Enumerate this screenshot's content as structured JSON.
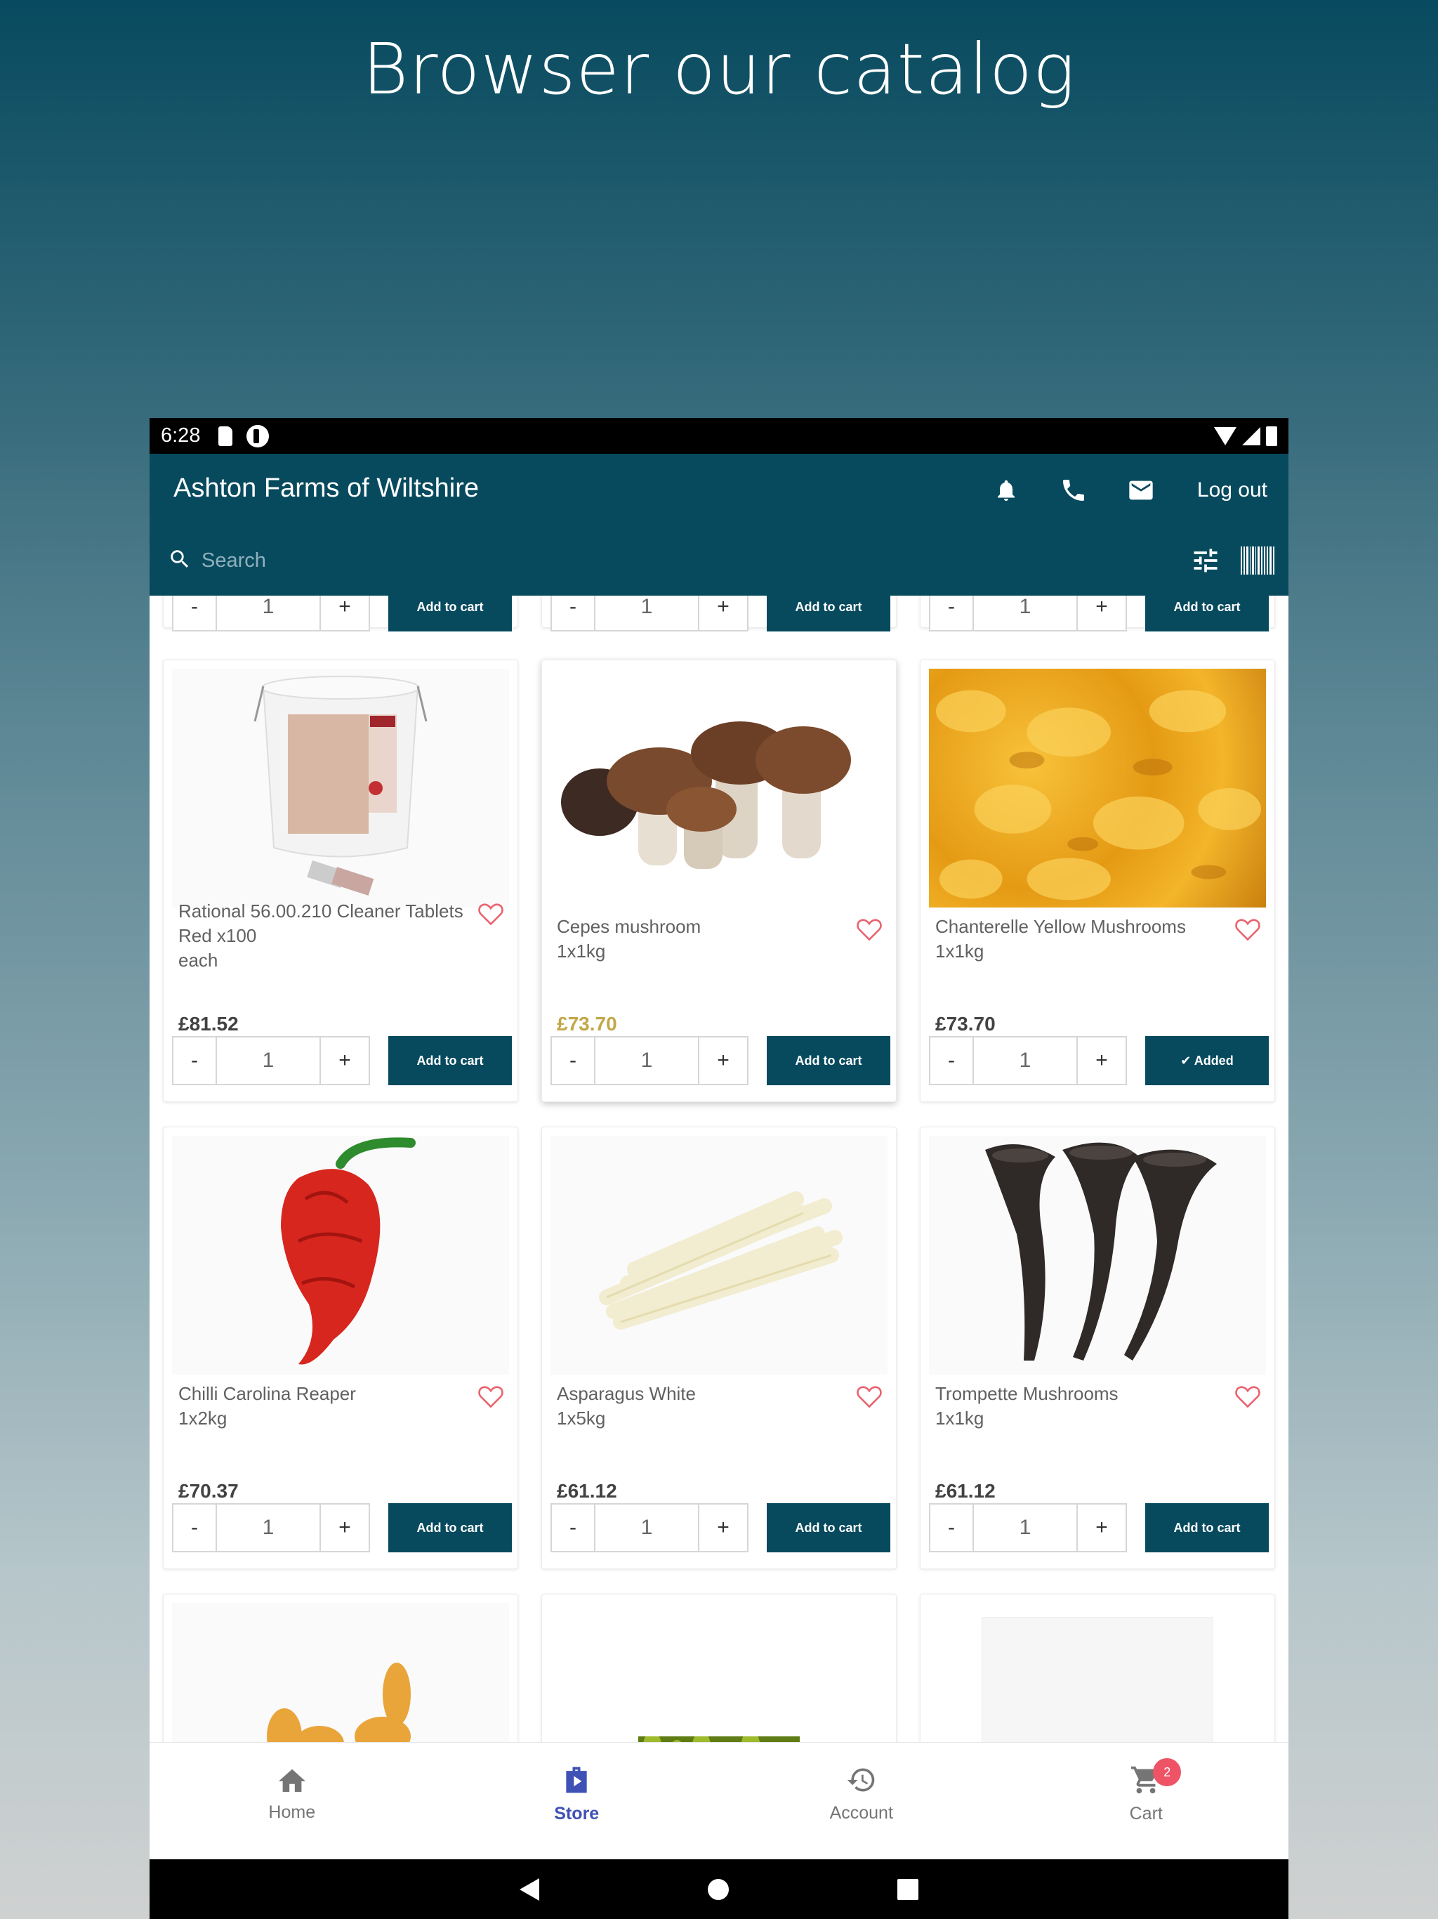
{
  "headline": "Browser our catalog",
  "status_bar": {
    "time": "6:28"
  },
  "app_bar": {
    "title": "Ashton Farms of Wiltshire",
    "logout_label": "Log out",
    "search_placeholder": "Search"
  },
  "colors": {
    "brand": "#074a5e",
    "sale_price": "#c2a747",
    "heart": "#e9636f",
    "active_nav": "#3f51b5",
    "badge": "#ef5366"
  },
  "partial_row": [
    {
      "qty": "1",
      "button": "Add to cart"
    },
    {
      "qty": "1",
      "button": "Add to cart"
    },
    {
      "qty": "1",
      "button": "Add to cart"
    }
  ],
  "products": [
    {
      "name": "Rational 56.00.210 Cleaner Tablets Red x100",
      "unit": "each",
      "price": "£81.52",
      "qty": "1",
      "button": "Add to cart",
      "image": "cleaner-tablets-bucket"
    },
    {
      "name": "Cepes mushroom",
      "unit": "1x1kg",
      "price": "£73.70",
      "qty": "1",
      "button": "Add to cart",
      "image": "cepes-mushrooms"
    },
    {
      "name": "Chanterelle Yellow Mushrooms",
      "unit": "1x1kg",
      "price": "£73.70",
      "qty": "1",
      "button": "✔ Added",
      "image": "chanterelle-mushrooms"
    },
    {
      "name": "Chilli Carolina Reaper",
      "unit": "1x2kg",
      "price": "£70.37",
      "qty": "1",
      "button": "Add to cart",
      "image": "carolina-reaper-chilli"
    },
    {
      "name": "Asparagus White",
      "unit": "1x5kg",
      "price": "£61.12",
      "qty": "1",
      "button": "Add to cart",
      "image": "white-asparagus"
    },
    {
      "name": "Trompette Mushrooms",
      "unit": "1x1kg",
      "price": "£61.12",
      "qty": "1",
      "button": "Add to cart",
      "image": "trompette-mushrooms"
    }
  ],
  "qty_controls": {
    "minus": "-",
    "plus": "+"
  },
  "bottom_nav": [
    {
      "label": "Home",
      "icon": "home-icon"
    },
    {
      "label": "Store",
      "icon": "store-icon",
      "active": true
    },
    {
      "label": "Account",
      "icon": "history-icon"
    },
    {
      "label": "Cart",
      "icon": "cart-icon",
      "badge": "2"
    }
  ]
}
